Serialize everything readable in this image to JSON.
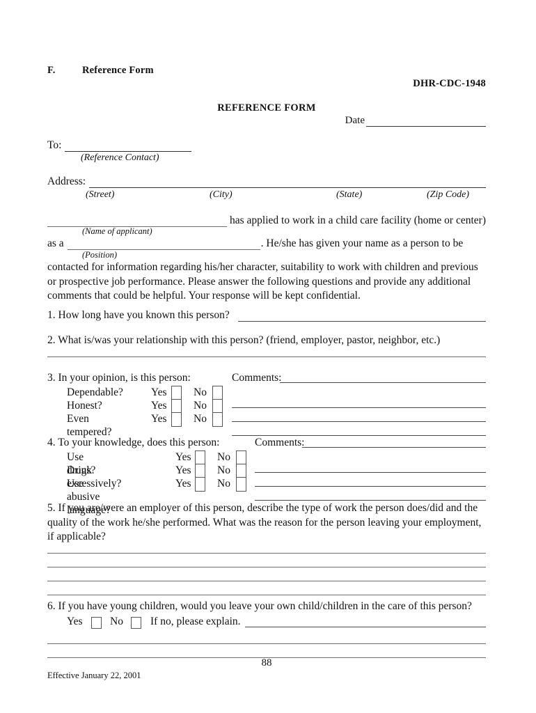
{
  "document": {
    "section_letter": "F.",
    "section_title": "Reference Form",
    "form_number": "DHR-CDC-1948",
    "form_title": "REFERENCE FORM",
    "date_label": "Date"
  },
  "recipient": {
    "to_label": "To:",
    "to_caption": "(Reference Contact)",
    "address_label": "Address:",
    "address_captions": {
      "street": "(Street)",
      "city": "(City)",
      "state": "(State)",
      "zip": "(Zip Code)"
    }
  },
  "applicant": {
    "applied_text": "has applied to work in a child care facility (home or center)",
    "name_caption": "(Name of applicant)",
    "as_a_label": "as a",
    "position_tail": ". He/she has given your name as a person to be",
    "position_caption": "(Position)"
  },
  "intro_paragraph": "contacted for information regarding his/her character, suitability to work with children and previous or prospective job performance. Please answer the following questions and provide any additional comments that could be helpful. Your response will be kept confidential.",
  "questions": {
    "q1": {
      "text": "1. How long have you known this person?"
    },
    "q2": {
      "text": "2. What is/was your relationship with this person? (friend, employer, pastor, neighbor, etc.)"
    },
    "q3": {
      "heading": "3. In your opinion, is this person:",
      "comments_label": "Comments:",
      "yes_label": "Yes",
      "no_label": "No",
      "items": [
        {
          "label": "Dependable?"
        },
        {
          "label": "Honest?"
        },
        {
          "label": "Even tempered?"
        }
      ],
      "comment_line_count": 3
    },
    "q4": {
      "heading": "4. To your knowledge, does this person:",
      "comments_label": "Comments:",
      "yes_label": "Yes",
      "no_label": "No",
      "items": [
        {
          "label": "Use drugs?"
        },
        {
          "label": "Drink excessively?"
        },
        {
          "label": "Use abusive language?"
        }
      ],
      "comment_line_count": 3
    },
    "q5": {
      "text": "5. If you are/were an employer of this person, describe the type of work the person does/did and the quality of the work he/she performed. What was the reason for the person leaving your employment, if applicable?",
      "answer_line_count": 4
    },
    "q6": {
      "heading": "6. If you have young children, would you leave your own child/children in the care of this person?",
      "yes_label": "Yes",
      "no_label": "No",
      "explain_label": "If no, please explain.",
      "answer_line_count": 2
    }
  },
  "footer": {
    "page_number": "88",
    "effective_date": "Effective January 22, 2001"
  },
  "colors": {
    "page_background": "#ffffff",
    "text": "#111111",
    "rule": "#4a4a4a",
    "box_border": "#555555"
  }
}
